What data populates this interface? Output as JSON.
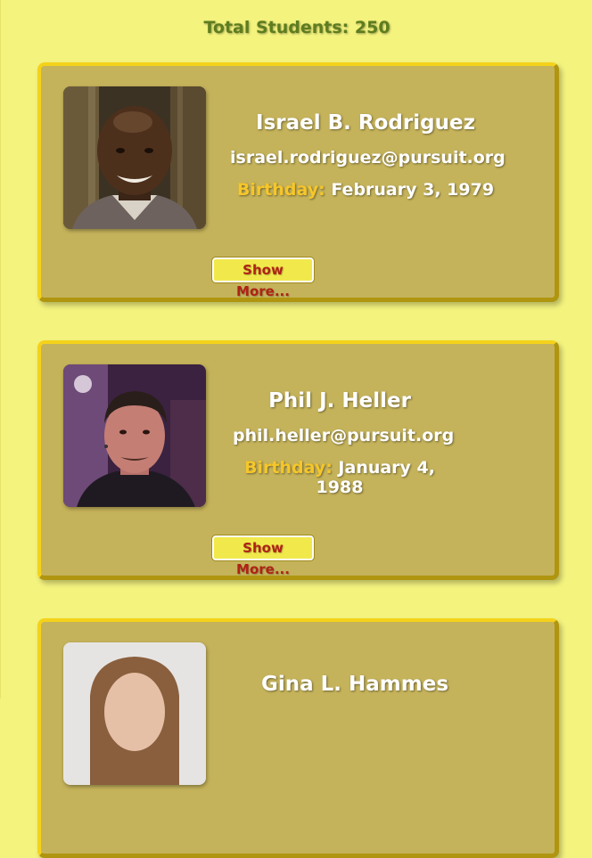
{
  "header": {
    "total_students": "Total Students: 250"
  },
  "students": [
    {
      "name": "Israel B. Rodriguez",
      "email": "israel.rodriguez@pursuit.org",
      "birthday_label": "Birthday:",
      "birthday": "February 3, 1979",
      "button_label": "Show More..."
    },
    {
      "name": "Phil J. Heller",
      "email": "phil.heller@pursuit.org",
      "birthday_label": "Birthday:",
      "birthday": "January 4, 1988",
      "button_label": "Show More..."
    },
    {
      "name": "Gina L. Hammes",
      "email": "",
      "birthday_label": "",
      "birthday": "",
      "button_label": ""
    }
  ],
  "colors": {
    "page_background": "#f4f37e",
    "card_background": "#c5b35b",
    "card_border": "#f5d21a",
    "birthday_label": "#f6c62a",
    "button_background": "#f1e94c",
    "button_text": "#b02216",
    "total_text": "#5e7d1e"
  }
}
